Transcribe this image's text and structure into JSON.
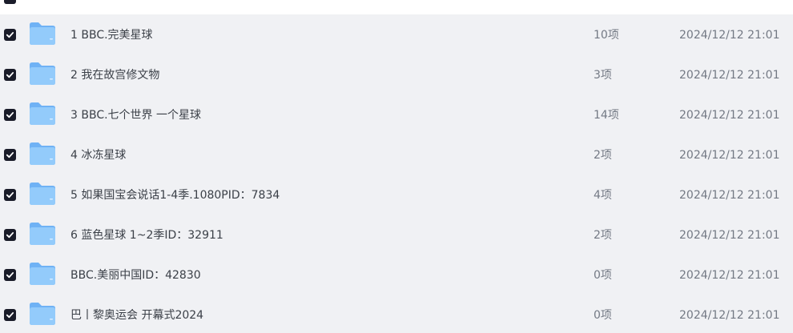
{
  "header": {
    "name_label": "",
    "count_label": "",
    "time_label": ""
  },
  "rows": [
    {
      "name": "1 BBC.完美星球",
      "count": "10项",
      "time": "2024/12/12 21:01"
    },
    {
      "name": "2 我在故宫修文物",
      "count": "3项",
      "time": "2024/12/12 21:01"
    },
    {
      "name": "3 BBC.七个世界 一个星球",
      "count": "14项",
      "time": "2024/12/12 21:01"
    },
    {
      "name": "4 冰冻星球",
      "count": "2项",
      "time": "2024/12/12 21:01"
    },
    {
      "name": "5 如果国宝会说话1-4季.1080PID：7834",
      "count": "4项",
      "time": "2024/12/12 21:01"
    },
    {
      "name": "6 蓝色星球 1~2季ID：32911",
      "count": "2项",
      "time": "2024/12/12 21:01"
    },
    {
      "name": "BBC.美丽中国ID：42830",
      "count": "0项",
      "time": "2024/12/12 21:01"
    },
    {
      "name": "巴丨黎奥运会 开幕式2024",
      "count": "0项",
      "time": "2024/12/12 21:01"
    }
  ],
  "icons": {
    "checkbox": "checkbox-checked-icon",
    "folder": "folder-icon"
  },
  "colors": {
    "row_background": "#f0f1f4",
    "checkbox": "#191b28",
    "folder_front": "#8fc8fb",
    "folder_back": "#6fb2f5"
  }
}
